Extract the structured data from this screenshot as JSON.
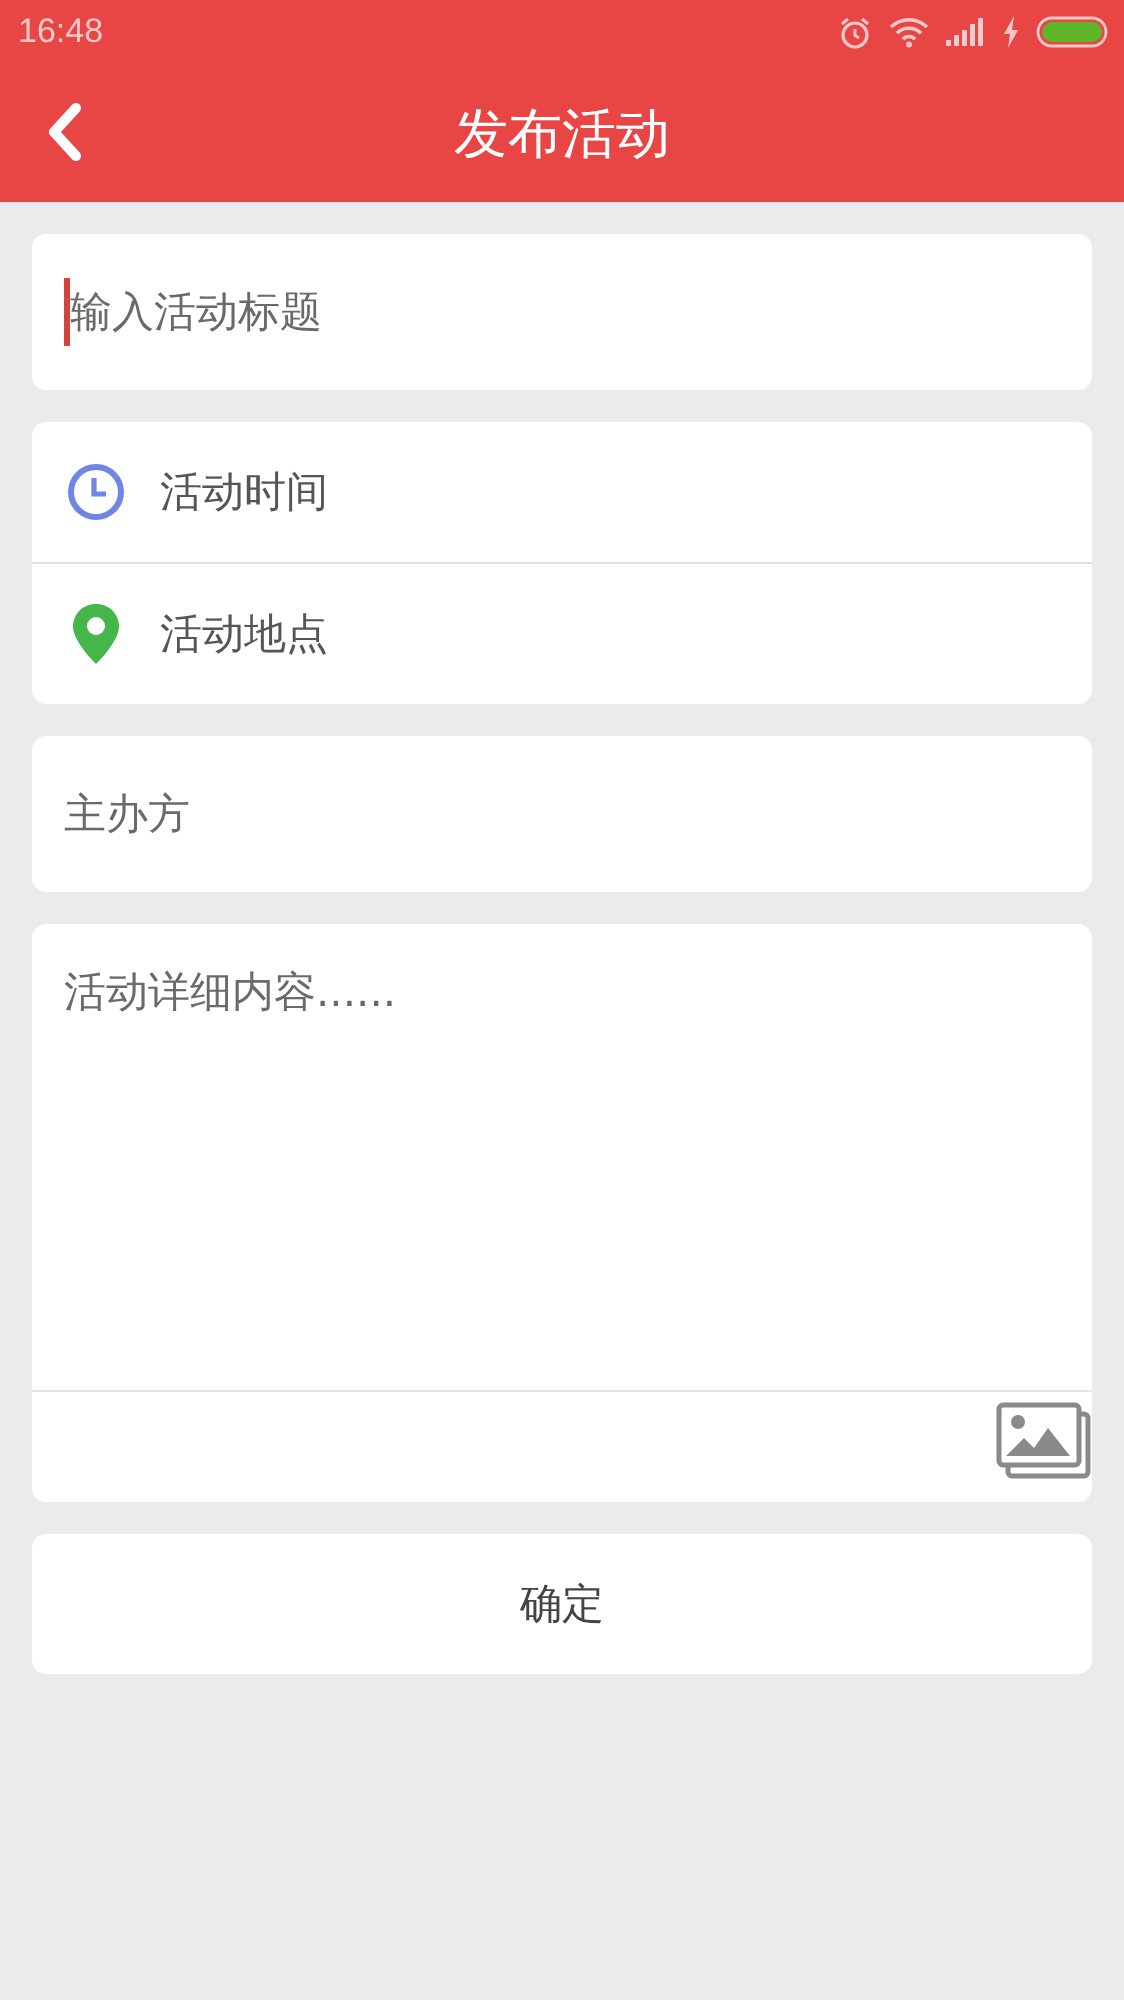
{
  "status_bar": {
    "time": "16:48"
  },
  "header": {
    "title": "发布活动"
  },
  "title_field": {
    "placeholder": "输入活动标题",
    "focused": true
  },
  "options": [
    {
      "kind": "time",
      "label": "活动时间"
    },
    {
      "kind": "place",
      "label": "活动地点"
    }
  ],
  "organizer_field": {
    "placeholder": "主办方"
  },
  "details_field": {
    "placeholder": "活动详细内容......"
  },
  "confirm_button": {
    "label": "确定"
  }
}
